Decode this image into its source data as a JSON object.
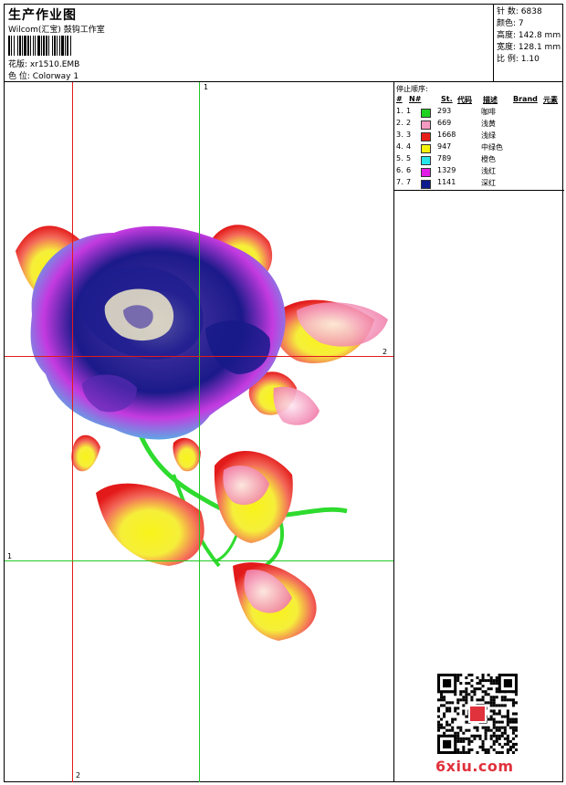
{
  "header": {
    "title": "生产作业图",
    "company": "Wilcom(汇宝) 鼓钩工作室",
    "design_file_label": "花版:",
    "design_file": "xr1510.EMB",
    "colorway_label": "色 位:",
    "colorway": "Colorway 1"
  },
  "stats": [
    {
      "label": "针 数:",
      "value": "6838"
    },
    {
      "label": "颜色:",
      "value": "7"
    },
    {
      "label": "高度:",
      "value": "142.8 mm"
    },
    {
      "label": "宽度:",
      "value": "128.1 mm"
    },
    {
      "label": "比 例:",
      "value": "1.10"
    }
  ],
  "legend": {
    "title": "停止顺序:",
    "columns": [
      "#",
      "N#",
      "St.",
      "代码",
      "描述",
      "Brand",
      "元素"
    ],
    "rows": [
      {
        "num": "1.",
        "n": "1",
        "color": "#1fd21f",
        "stitches": "293",
        "desc": "咖啡"
      },
      {
        "num": "2.",
        "n": "2",
        "color": "#f59ac0",
        "stitches": "669",
        "desc": "浅黄"
      },
      {
        "num": "3.",
        "n": "3",
        "color": "#e8201a",
        "stitches": "1668",
        "desc": "浅绿"
      },
      {
        "num": "4.",
        "n": "4",
        "color": "#f5f20a",
        "stitches": "947",
        "desc": "中绿色"
      },
      {
        "num": "5.",
        "n": "5",
        "color": "#27e5ea",
        "stitches": "789",
        "desc": "橙色"
      },
      {
        "num": "6.",
        "n": "6",
        "color": "#e21ee6",
        "stitches": "1329",
        "desc": "浅红"
      },
      {
        "num": "7.",
        "n": "7",
        "color": "#0e1b8c",
        "stitches": "1141",
        "desc": "深红"
      }
    ]
  },
  "guides": {
    "top_label": "1",
    "right_label": "2",
    "left_label": "1",
    "bottom_label": "2"
  },
  "watermark": "6xiu.com"
}
